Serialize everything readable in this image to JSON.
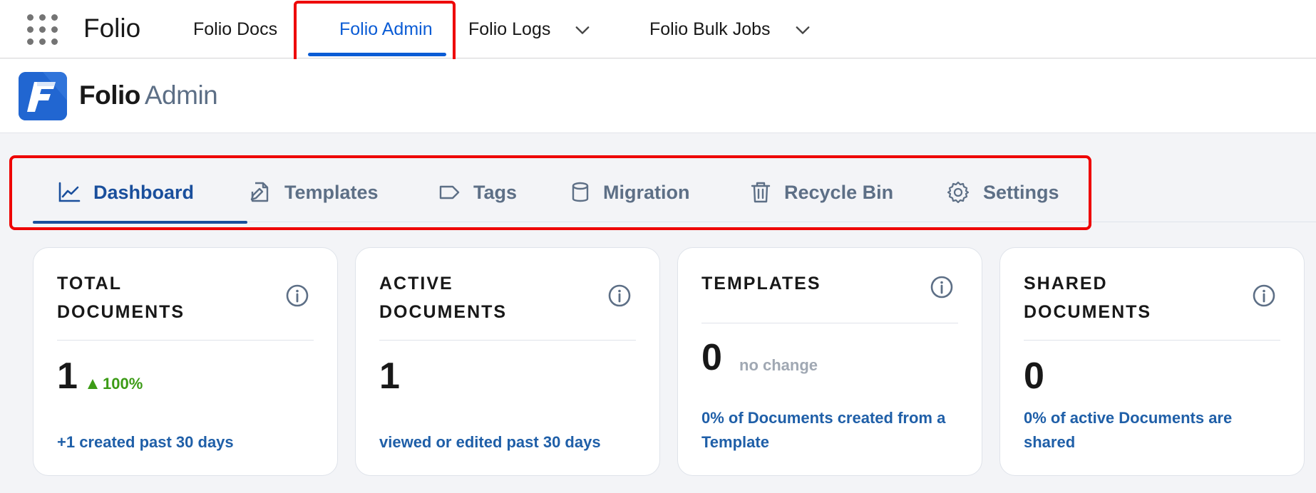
{
  "global_nav": {
    "app_launcher_icon": "grid-icon",
    "app_name": "Folio",
    "tabs": [
      {
        "label": "Folio Docs",
        "active": false,
        "has_menu": false
      },
      {
        "label": "Folio Admin",
        "active": true,
        "has_menu": false
      },
      {
        "label": "Folio Logs",
        "active": false,
        "has_menu": true
      },
      {
        "label": "Folio Bulk Jobs",
        "active": false,
        "has_menu": true
      }
    ]
  },
  "app_header": {
    "logo_letter": "F",
    "title": "Folio",
    "subtitle": "Admin"
  },
  "sub_tabs": [
    {
      "label": "Dashboard",
      "icon": "line-chart-icon",
      "active": true
    },
    {
      "label": "Templates",
      "icon": "edit-document-icon",
      "active": false
    },
    {
      "label": "Tags",
      "icon": "tag-icon",
      "active": false
    },
    {
      "label": "Migration",
      "icon": "database-icon",
      "active": false
    },
    {
      "label": "Recycle Bin",
      "icon": "trash-icon",
      "active": false
    },
    {
      "label": "Settings",
      "icon": "gear-icon",
      "active": false
    }
  ],
  "cards": [
    {
      "title": "Total Documents",
      "value": "1",
      "delta": "100%",
      "footer": "+1 created past 30 days"
    },
    {
      "title": "Active Documents",
      "value": "1",
      "footer": "viewed or edited past 30 days"
    },
    {
      "title": "Templates",
      "value": "0",
      "change_text": "no change",
      "footer": "0% of Documents created from a Template"
    },
    {
      "title": "Shared Documents",
      "value": "0",
      "footer": "0% of active Documents are shared"
    }
  ],
  "colors": {
    "accent_blue": "#0b5cd5",
    "tab_active": "#1a4f9c",
    "highlight_red": "#ee0000",
    "positive_green": "#3c9b16",
    "link_blue": "#1f5fa8"
  }
}
